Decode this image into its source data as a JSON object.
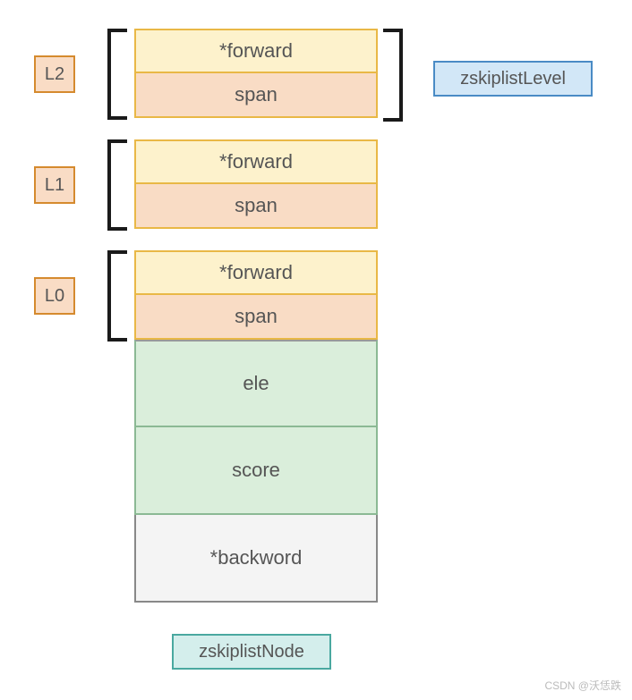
{
  "levels": {
    "l2": {
      "label": "L2",
      "forward": "*forward",
      "span": "span"
    },
    "l1": {
      "label": "L1",
      "forward": "*forward",
      "span": "span"
    },
    "l0": {
      "label": "L0",
      "forward": "*forward",
      "span": "span"
    }
  },
  "node_fields": {
    "ele": "ele",
    "score": "score",
    "backword": "*backword"
  },
  "labels": {
    "zskiplistLevel": "zskiplistLevel",
    "zskiplistNode": "zskiplistNode"
  },
  "watermark": "CSDN @沃恁跌"
}
